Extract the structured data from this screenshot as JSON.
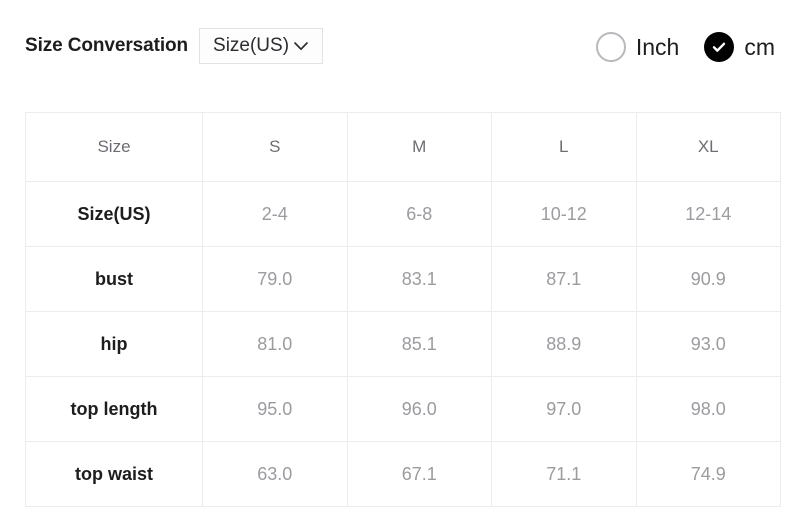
{
  "header": {
    "conversion_label": "Size Conversation",
    "size_select": {
      "value": "Size(US)",
      "icon": "chevron-down-icon"
    },
    "units": [
      {
        "label": "Inch",
        "selected": false
      },
      {
        "label": "cm",
        "selected": true
      }
    ]
  },
  "table": {
    "columns": [
      "Size",
      "S",
      "M",
      "L",
      "XL"
    ],
    "rows": [
      {
        "label": "Size(US)",
        "values": [
          "2-4",
          "6-8",
          "10-12",
          "12-14"
        ]
      },
      {
        "label": "bust",
        "values": [
          "79.0",
          "83.1",
          "87.1",
          "90.9"
        ]
      },
      {
        "label": "hip",
        "values": [
          "81.0",
          "85.1",
          "88.9",
          "93.0"
        ]
      },
      {
        "label": "top length",
        "values": [
          "95.0",
          "96.0",
          "97.0",
          "98.0"
        ]
      },
      {
        "label": "top waist",
        "values": [
          "63.0",
          "67.1",
          "71.1",
          "74.9"
        ]
      }
    ]
  },
  "colors": {
    "accent": "#000000",
    "border": "#ececee",
    "value_text": "#9b9ba0",
    "label_text": "#1d1d1f",
    "header_text": "#6d6d73"
  }
}
